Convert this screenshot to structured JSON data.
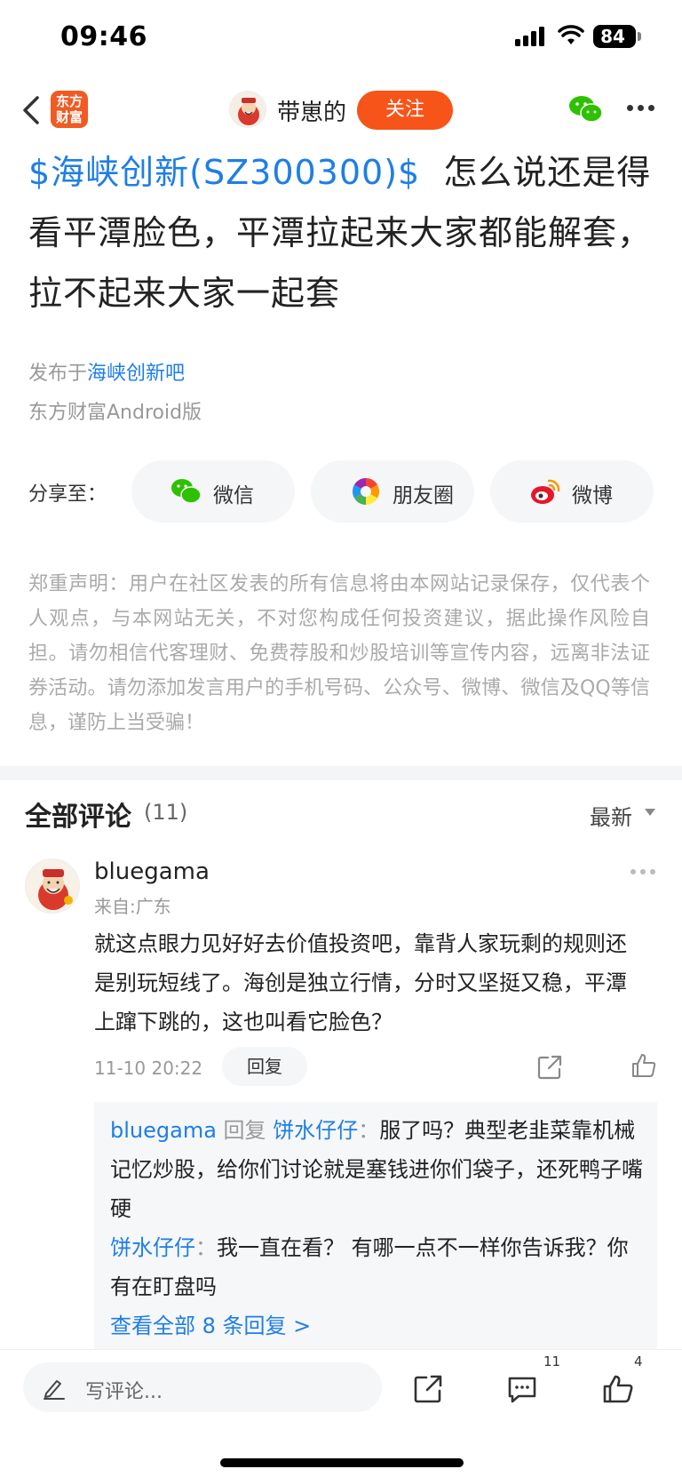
{
  "status_bar": {
    "time": "09:46",
    "battery": "84"
  },
  "nav": {
    "app_logo": "东方财富",
    "author": "带崽的",
    "follow_label": "关注"
  },
  "post": {
    "stock_tag": "$海峡创新(SZ300300)$",
    "text": "怎么说还是得看平潭脸色，平潭拉起来大家都能解套，拉不起来大家一起套",
    "published_prefix": "发布于",
    "forum": "海峡创新吧",
    "source": "东方财富Android版"
  },
  "share": {
    "label": "分享至：",
    "targets": [
      {
        "label": "微信",
        "icon": "wechat-icon"
      },
      {
        "label": "朋友圈",
        "icon": "moments-icon"
      },
      {
        "label": "微博",
        "icon": "weibo-icon"
      }
    ]
  },
  "disclaimer": "郑重声明：用户在社区发表的所有信息将由本网站记录保存，仅代表个人观点，与本网站无关，不对您构成任何投资建议，据此操作风险自担。请勿相信代客理财、免费荐股和炒股培训等宣传内容，远离非法证券活动。请勿添加发言用户的手机号码、公众号、微博、微信及QQ等信息，谨防上当受骗！",
  "comments": {
    "title": "全部评论",
    "count": "(11)",
    "sort": "最新",
    "items": [
      {
        "user": "bluegama",
        "location": "来自:广东",
        "text": "就这点眼力见好好去价值投资吧，靠背人家玩剩的规则还是别玩短线了。海创是独立行情，分时又坚挺又稳，平潭上蹿下跳的，这也叫看它脸色？",
        "time": "11-10 20:22",
        "reply_label": "回复",
        "replies": [
          {
            "from": "bluegama",
            "verb": "回复",
            "to": "饼水仔仔",
            "sep": "：",
            "text": "服了吗？典型老韭菜靠机械记忆炒股，给你们讨论就是塞钱进你们袋子，还死鸭子嘴硬"
          },
          {
            "from": "饼水仔仔",
            "sep": "：",
            "text": "我一直在看？ 有哪一点不一样你告诉我？你有在盯盘吗"
          }
        ],
        "view_all": "查看全部 8 条回复 >"
      }
    ]
  },
  "bottom_bar": {
    "placeholder": "写评论...",
    "comment_count": "11",
    "like_count": "4"
  },
  "colors": {
    "accent": "#f7541a",
    "link": "#1e7ee6",
    "muted": "#999999"
  }
}
